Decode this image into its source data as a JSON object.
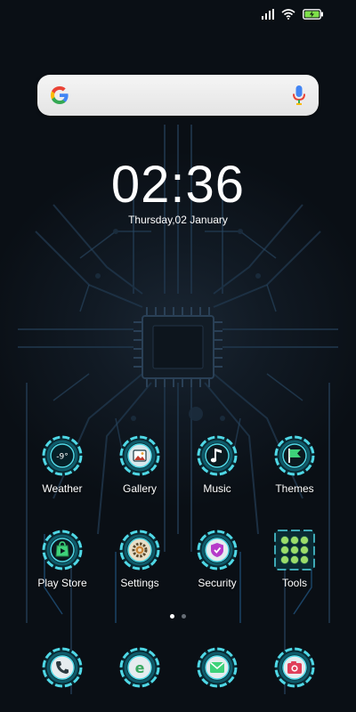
{
  "status_bar": {
    "signal": "signal-bars-icon",
    "wifi": "wifi-icon",
    "battery": "battery-charging-icon",
    "battery_color": "#7ee04a"
  },
  "search": {
    "logo": "google-g-icon",
    "mic": "microphone-icon",
    "placeholder": ""
  },
  "clock": {
    "time": "02:36",
    "date": "Thursday,02 January"
  },
  "apps": [
    {
      "label": "Weather",
      "icon": "weather-icon",
      "value": "-9°"
    },
    {
      "label": "Gallery",
      "icon": "gallery-icon"
    },
    {
      "label": "Music",
      "icon": "music-note-icon"
    },
    {
      "label": "Themes",
      "icon": "themes-flag-icon"
    },
    {
      "label": "Play Store",
      "icon": "play-store-icon"
    },
    {
      "label": "Settings",
      "icon": "settings-gear-icon"
    },
    {
      "label": "Security",
      "icon": "security-shield-icon"
    },
    {
      "label": "Tools",
      "icon": "tools-grid-icon"
    }
  ],
  "page_indicator": {
    "pages": 2,
    "current": 1
  },
  "dock": [
    {
      "icon": "phone-icon"
    },
    {
      "icon": "browser-icon"
    },
    {
      "icon": "messages-icon"
    },
    {
      "icon": "camera-icon"
    }
  ],
  "colors": {
    "ring": "#4fd8e6",
    "ring_dark": "#0f5b6a",
    "label": "#ffffff"
  }
}
